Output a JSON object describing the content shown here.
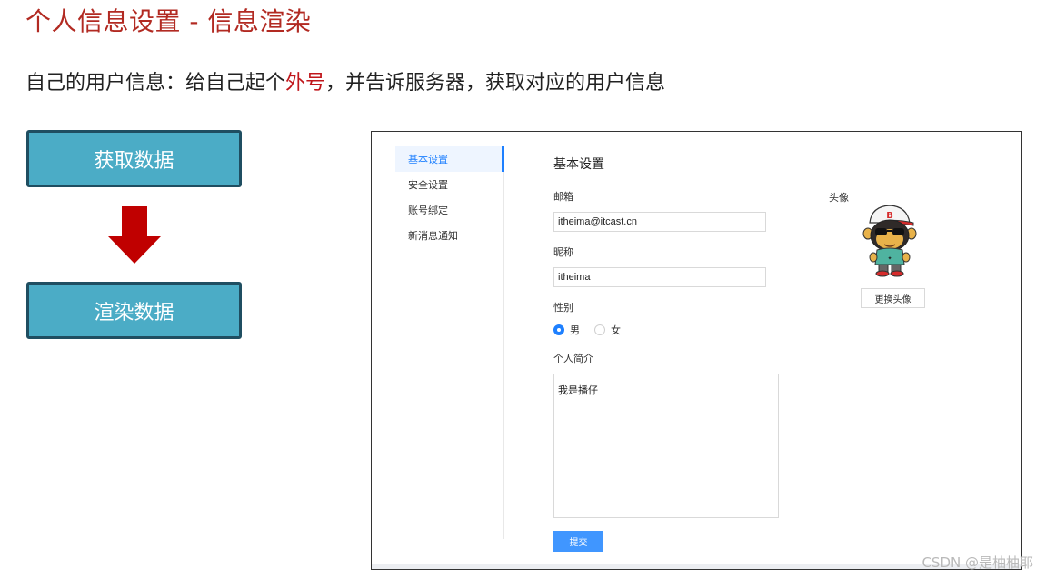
{
  "slide": {
    "title": "个人信息设置 - 信息渲染",
    "subtitle_before": "自己的用户信息：给自己起个",
    "subtitle_highlight": "外号",
    "subtitle_after": "，并告诉服务器，获取对应的用户信息",
    "flow": {
      "step1": "获取数据",
      "step2": "渲染数据"
    },
    "colors": {
      "title": "#b22a22",
      "highlight": "#c0161b",
      "flow_box": "#4bacc6",
      "arrow": "#c00000"
    },
    "watermark": "CSDN @是柚柚耶"
  },
  "mock": {
    "menu": [
      {
        "label": "基本设置",
        "active": true
      },
      {
        "label": "安全设置",
        "active": false
      },
      {
        "label": "账号绑定",
        "active": false
      },
      {
        "label": "新消息通知",
        "active": false
      }
    ],
    "section_title": "基本设置",
    "email": {
      "label": "邮箱",
      "value": "itheima@itcast.cn"
    },
    "nickname": {
      "label": "昵称",
      "value": "itheima"
    },
    "gender": {
      "label": "性别",
      "options": [
        "男",
        "女"
      ],
      "selected": "男"
    },
    "intro": {
      "label": "个人简介",
      "value": "我是播仔"
    },
    "submit_label": "提交",
    "avatar": {
      "label": "头像",
      "icon": "monkey-avatar-icon",
      "change_label": "更换头像"
    },
    "colors": {
      "accent": "#1e80ff",
      "submit": "#4096ff"
    }
  }
}
